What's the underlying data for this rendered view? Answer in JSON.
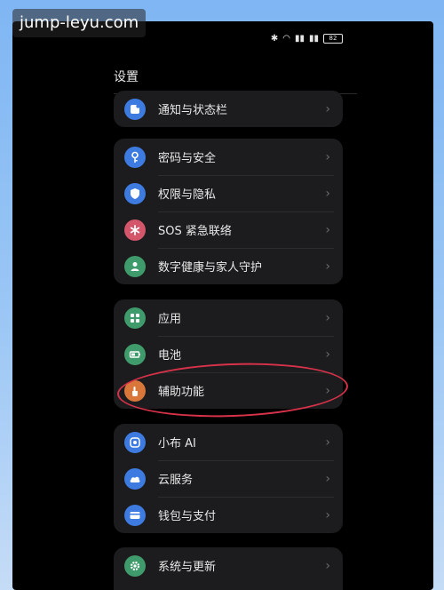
{
  "watermark": "jump-leyu.com",
  "status": {
    "battery": "82"
  },
  "header": {
    "title": "设置"
  },
  "groups": [
    {
      "items": [
        {
          "label": "通知与状态栏",
          "icon": "notification-icon",
          "color": "#3d7be0"
        }
      ]
    },
    {
      "items": [
        {
          "label": "密码与安全",
          "icon": "key-icon",
          "color": "#3d7be0"
        },
        {
          "label": "权限与隐私",
          "icon": "shield-icon",
          "color": "#3d7be0"
        },
        {
          "label": "SOS 紧急联络",
          "icon": "asterisk-icon",
          "color": "#d4566a"
        },
        {
          "label": "数字健康与家人守护",
          "icon": "person-icon",
          "color": "#3f9b6b"
        }
      ]
    },
    {
      "items": [
        {
          "label": "应用",
          "icon": "apps-icon",
          "color": "#3f9b6b"
        },
        {
          "label": "电池",
          "icon": "battery-icon",
          "color": "#3f9b6b"
        },
        {
          "label": "辅助功能",
          "icon": "hand-icon",
          "color": "#d9773a"
        }
      ]
    },
    {
      "items": [
        {
          "label": "小布 AI",
          "icon": "ai-icon",
          "color": "#3d7be0"
        },
        {
          "label": "云服务",
          "icon": "cloud-icon",
          "color": "#3d7be0"
        },
        {
          "label": "钱包与支付",
          "icon": "wallet-icon",
          "color": "#3d7be0"
        }
      ]
    },
    {
      "items": [
        {
          "label": "系统与更新",
          "icon": "gear-icon",
          "color": "#3f9b6b"
        }
      ]
    }
  ]
}
